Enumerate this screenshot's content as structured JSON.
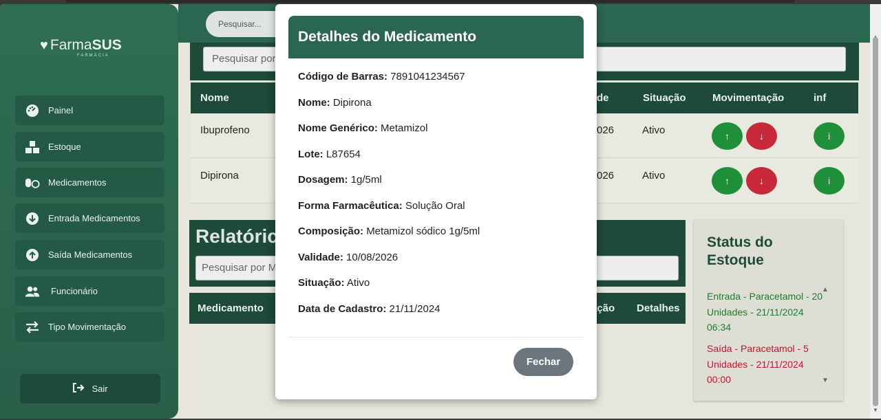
{
  "sidebar": {
    "logo_prefix": "Farma",
    "logo_bold": "SUS",
    "logo_sub": "FARMÁCIA",
    "items": [
      {
        "label": "Painel",
        "icon": "dashboard-icon"
      },
      {
        "label": "Estoque",
        "icon": "boxes-icon"
      },
      {
        "label": "Medicamentos",
        "icon": "pills-icon"
      },
      {
        "label": "Entrada Medicamentos",
        "icon": "arrow-down-circle-icon"
      },
      {
        "label": "Saída Medicamentos",
        "icon": "arrow-up-circle-icon"
      },
      {
        "label": "Funcionário",
        "icon": "users-icon"
      },
      {
        "label": "Tipo Movimentação",
        "icon": "exchange-icon"
      }
    ],
    "logout_label": "Sair"
  },
  "header": {
    "search_placeholder": "Pesquisar..."
  },
  "stock": {
    "search_placeholder": "Pesquisar por",
    "columns": [
      "Nome",
      "de",
      "Situação",
      "Movimentação",
      "inf"
    ],
    "rows": [
      {
        "name": "Ibuprofeno",
        "date": "026",
        "status": "Ativo"
      },
      {
        "name": "Dipirona",
        "date": "026",
        "status": "Ativo"
      }
    ],
    "btn_up": "↑",
    "btn_down": "↓",
    "btn_info": "i"
  },
  "report": {
    "title": "Relatóric",
    "search_placeholder": "Pesquisar por M",
    "columns": [
      "Medicamento",
      "ação",
      "Detalhes"
    ]
  },
  "status_panel": {
    "title": "Status do Estoque",
    "entries": [
      {
        "text": "Entrada - Paracetamol - 20 Unidades - 21/11/2024 06:34",
        "color": "#1f7a2e"
      },
      {
        "text": "Saída - Paracetamol - 5 Unidades - 21/11/2024 00:00",
        "color": "#c8102e"
      }
    ]
  },
  "modal": {
    "title": "Detalhes do Medicamento",
    "fields": [
      {
        "label": "Código de Barras:",
        "value": "7891041234567"
      },
      {
        "label": "Nome:",
        "value": "Dipirona"
      },
      {
        "label": "Nome Genérico:",
        "value": "Metamizol"
      },
      {
        "label": "Lote:",
        "value": "L87654"
      },
      {
        "label": "Dosagem:",
        "value": "1g/5ml"
      },
      {
        "label": "Forma Farmacêutica:",
        "value": "Solução Oral"
      },
      {
        "label": "Composição:",
        "value": "Metamizol sódico 1g/5ml"
      },
      {
        "label": "Validade:",
        "value": "10/08/2026"
      },
      {
        "label": "Situação:",
        "value": "Ativo"
      },
      {
        "label": "Data de Cadastro:",
        "value": "21/11/2024"
      }
    ],
    "close_label": "Fechar"
  },
  "colors": {
    "primary": "#2b6650",
    "dark": "#1e4a3a",
    "success": "#1f8f3a",
    "danger": "#c8293a",
    "secondary": "#6c757d"
  }
}
